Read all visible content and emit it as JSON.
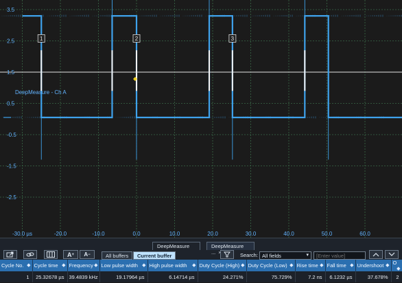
{
  "plot": {
    "y_ticks": [
      {
        "label": "3.5",
        "v": 3.5
      },
      {
        "label": "2.5",
        "v": 2.5
      },
      {
        "label": "1.5",
        "v": 1.5
      },
      {
        "label": "0.5",
        "v": 0.5
      },
      {
        "label": "-0.5",
        "v": -0.5
      },
      {
        "label": "-1.5",
        "v": -1.5
      },
      {
        "label": "-2.5",
        "v": -2.5
      }
    ],
    "x_ticks": [
      {
        "label": "-30.0 µs",
        "v": -30
      },
      {
        "label": "-20.0",
        "v": -20
      },
      {
        "label": "-10.0",
        "v": -10
      },
      {
        "label": "0.0",
        "v": 0
      },
      {
        "label": "10.0",
        "v": 10
      },
      {
        "label": "20.0",
        "v": 20
      },
      {
        "label": "30.0",
        "v": 30
      },
      {
        "label": "40.0",
        "v": 40
      },
      {
        "label": "50.0",
        "v": 50
      },
      {
        "label": "60.0",
        "v": 60
      }
    ],
    "channel_label": "DeepMeasure - Ch A",
    "threshold_volts": 1.5,
    "trigger_time_us": 0,
    "colors": {
      "trace": "#3fa2ec",
      "label": "#62b3ff",
      "grid": "#3a6848",
      "threshold": "#e6e6e6",
      "trigger": "#f0d020",
      "background": "#1b1b1b"
    },
    "edges": [
      {
        "time_us": -25.0,
        "dir": "fall"
      },
      {
        "time_us": -6.4,
        "dir": "rise"
      },
      {
        "time_us": 0.0,
        "dir": "fall"
      },
      {
        "time_us": 19.1,
        "dir": "rise"
      },
      {
        "time_us": 25.2,
        "dir": "fall"
      },
      {
        "time_us": 44.2,
        "dir": "rise"
      },
      {
        "time_us": 50.4,
        "dir": "fall"
      }
    ],
    "high_volts": 3.3,
    "low_volts": 0.05,
    "cycle_markers": [
      {
        "label": "1",
        "time_us": -25.0
      },
      {
        "label": "2",
        "time_us": 0.0
      },
      {
        "label": "3",
        "time_us": 25.2
      }
    ],
    "rise_markers_us": [
      -6.4,
      19.1,
      44.2
    ]
  },
  "toolbar": {
    "export_icon": "export-icon",
    "link_icon": "link-icon",
    "columns_icon": "columns-icon",
    "font_increase_label": "A",
    "font_decrease_label": "A",
    "tabs": [
      {
        "label": "DeepMeasure ...",
        "close": "×"
      },
      {
        "label": "DeepMeasure ...",
        "close": "×"
      }
    ],
    "all_buffers": "All buffers",
    "current_buffer": "Current buffer",
    "filter_icon": "filter-icon",
    "search_label": "Search:",
    "search_field": "All fields",
    "search_placeholder": "[Enter value]",
    "nav_up_icon": "chevron-up-icon",
    "nav_down_icon": "chevron-down-icon"
  },
  "table": {
    "headers": [
      "Cycle No.",
      "Cycle time",
      "Frequency",
      "Low pulse width",
      "High pulse width",
      "Duty Cycle (High)",
      "Duty Cycle (Low)",
      "Rise time",
      "Fall time",
      "Undershoot",
      "O"
    ],
    "rows": [
      [
        "1",
        "25.32678 µs",
        "39.4839 kHz",
        "19.17964 µs",
        "6.14714 µs",
        "24.271%",
        "75.729%",
        "7.2 ns",
        "6.1232 µs",
        "37.678%",
        "2"
      ]
    ]
  }
}
